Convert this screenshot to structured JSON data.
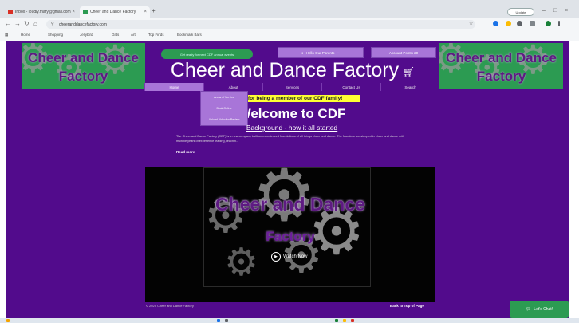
{
  "browser": {
    "tabs": [
      {
        "label": "Inbox - loudly.mary@gmail.com",
        "active": false,
        "favicon_color": "#d93025"
      },
      {
        "label": "Cheer and Dance Factory",
        "active": true,
        "favicon_color": "#2c9b52"
      }
    ],
    "new_tab": "+",
    "update_label": "Update",
    "url": "cheeranddancefactory.com",
    "bookmarks": [
      "Home",
      "Shopping",
      "Jellybird",
      "Gifts",
      "Art",
      "Top Finds",
      "Bookmark Bars"
    ]
  },
  "site": {
    "logo_line1": "Cheer and Dance",
    "logo_line2": "Factory",
    "promo": "Get ready for next CDF annual events",
    "header_buttons": {
      "parents": "Hello Our Parents",
      "account": "Account Points 20"
    },
    "title": "Cheer and Dance Factory",
    "nav": [
      "Home",
      "About",
      "Services",
      "Contact Us",
      "Search"
    ],
    "dropdown": [
      "Areas of Service",
      "Book Online",
      "Upload Video for Review"
    ],
    "banner": "Thank you for being a member of our CDF family!",
    "welcome": "Welcome to CDF",
    "background_link": "Background - how it all started",
    "intro": "The Cheer and Dance Factory (CDF) is a new company built on experienced foundations of all things cheer and dance. The founders are steeped in cheer and dance with multiple years of experience leading, teachin...",
    "read_more": "Read more",
    "hero_title": "Cheer and Dance",
    "hero_subtitle": "Factory",
    "hero_play": "Watch Now",
    "copyright": "© 2025 Cheer and Dance Factory",
    "back_to_top": "Back to Top of Page",
    "chat": "Let's Chat!"
  },
  "colors": {
    "site_bg": "#520b8c",
    "accent_purple": "#a875d8",
    "accent_green": "#2c9b52",
    "banner_yellow": "#ffff33"
  }
}
